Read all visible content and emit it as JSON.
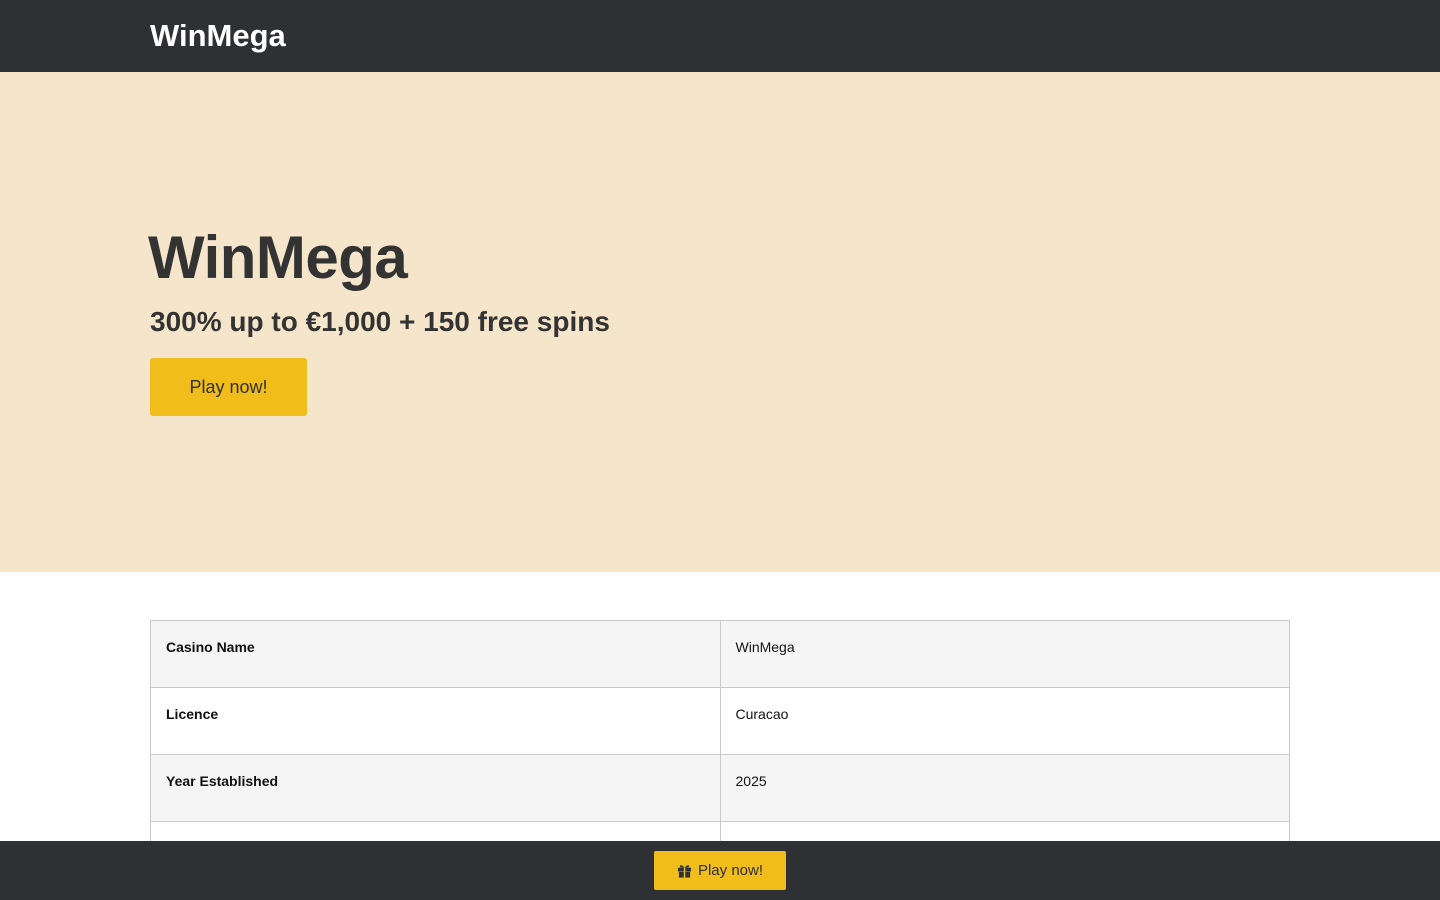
{
  "header": {
    "logo": "WinMega"
  },
  "hero": {
    "title": "WinMega",
    "subtitle": "300% up to €1,000 + 150 free spins",
    "cta_label": "Play now!"
  },
  "info_table": {
    "rows": [
      {
        "key": "Casino Name",
        "value": "WinMega"
      },
      {
        "key": "Licence",
        "value": "Curacao"
      },
      {
        "key": "Year Established",
        "value": "2025"
      },
      {
        "key": "",
        "value": ""
      }
    ]
  },
  "sticky_footer": {
    "cta_label": "Play now!",
    "icon": "gift-icon"
  },
  "colors": {
    "header_bg": "#2f3033",
    "hero_bg": "#f5e5ca",
    "accent": "#f0bd1b"
  }
}
